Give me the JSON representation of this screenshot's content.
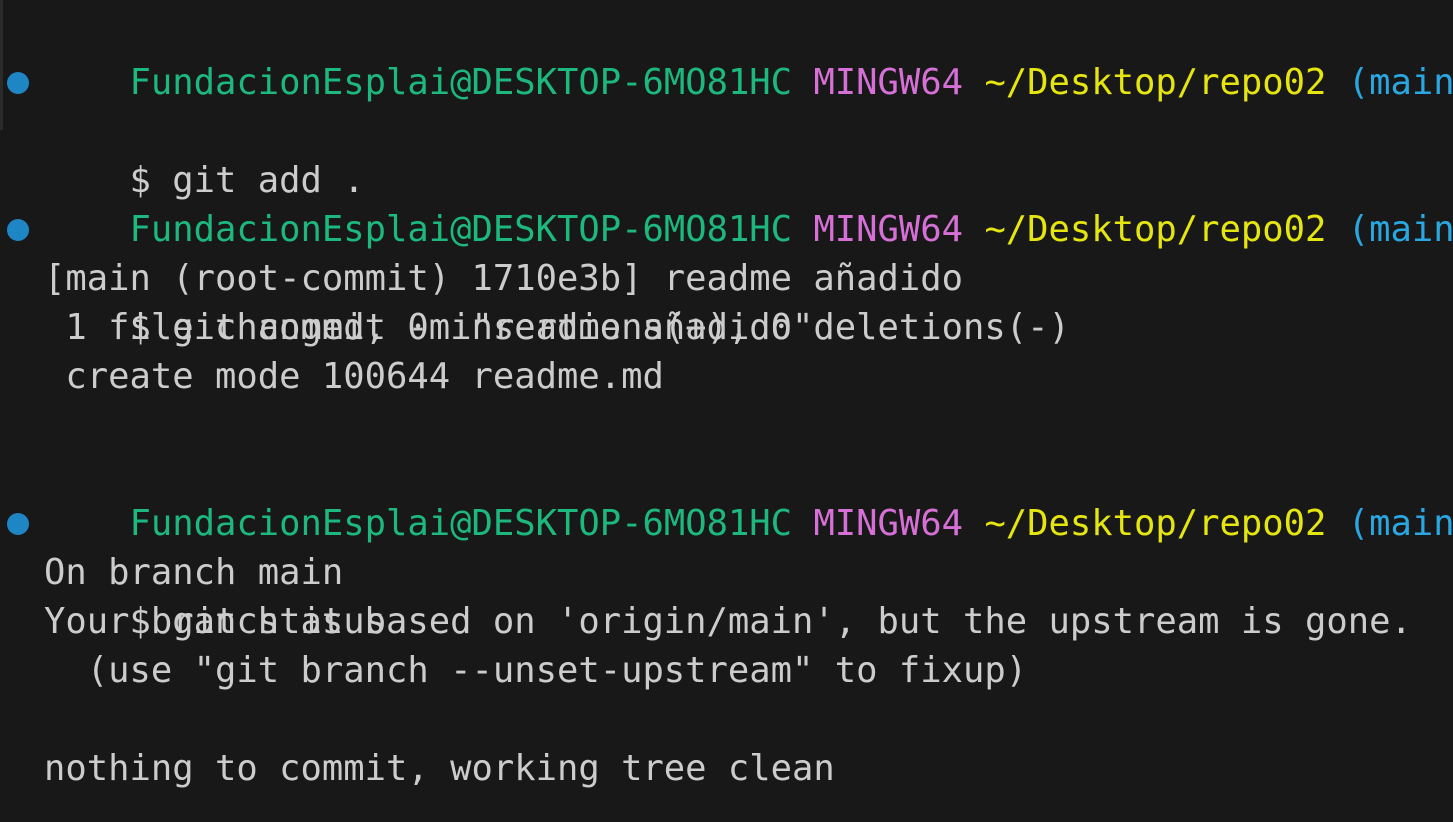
{
  "prompt": {
    "user": "FundacionEsplai@DESKTOP-6MO81HC",
    "system": "MINGW64",
    "path": "~/Desktop/repo02",
    "branch": "(main)"
  },
  "blocks": [
    {
      "command": "$ git add .",
      "output": []
    },
    {
      "command": "$ git commit -m \"readme añadido\"",
      "output": [
        "[main (root-commit) 1710e3b] readme añadido",
        " 1 file changed, 0 insertions(+), 0 deletions(-)",
        " create mode 100644 readme.md"
      ]
    },
    {
      "command": "$ git status",
      "output": [
        "On branch main",
        "Your branch is based on 'origin/main', but the upstream is gone.",
        "  (use \"git branch --unset-upstream\" to fixup)",
        "",
        "nothing to commit, working tree clean"
      ]
    }
  ],
  "colors": {
    "background": "#181818",
    "user": "#1db87e",
    "system": "#d670d6",
    "path": "#e5e510",
    "branch": "#2aa7e0",
    "text": "#cccccc",
    "command_decoration": "#1f86c5"
  },
  "icons": {
    "command_decoration": "command-status-dot-icon"
  }
}
